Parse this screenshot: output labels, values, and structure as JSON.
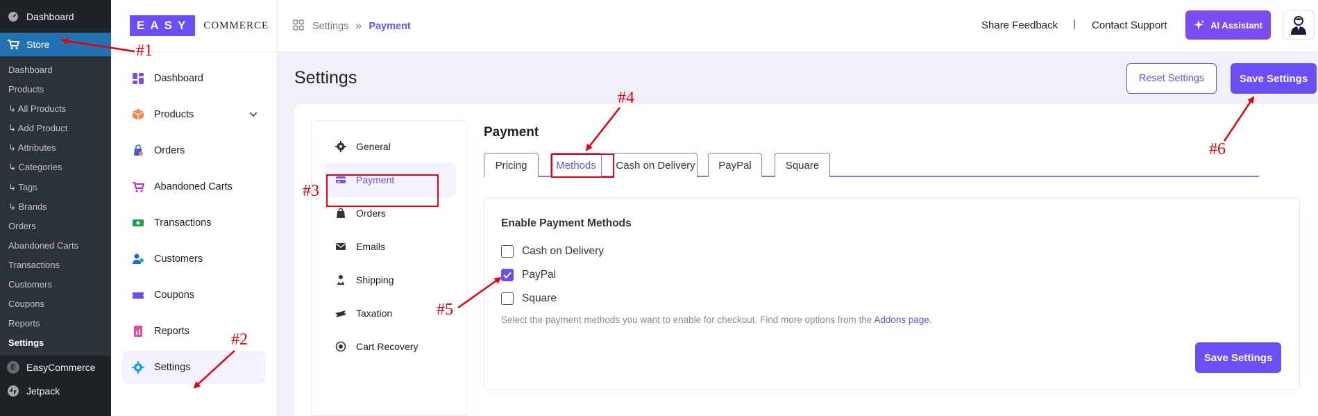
{
  "wp_sidebar": {
    "dashboard_label": "Dashboard",
    "store_label": "Store",
    "submenu": [
      "Dashboard",
      "Products",
      "�ₗ All Products",
      "�ₗ Add Product",
      "�ₗ Attributes",
      "�ₗ Categories",
      "�ₗ Tags",
      "�ₗ Brands",
      "Orders",
      "Abandoned Carts",
      "Transactions",
      "Customers",
      "Coupons",
      "Reports",
      "Settings"
    ],
    "easycommerce_label": "EasyCommerce",
    "easycommerce_initial": "E",
    "jetpack_label": "Jetpack"
  },
  "logo": {
    "box_text": "EASY",
    "text": "COMMERCE"
  },
  "ec_nav": {
    "items": [
      {
        "label": "Dashboard",
        "icon": "dashboard-icon"
      },
      {
        "label": "Products",
        "icon": "products-icon"
      },
      {
        "label": "Orders",
        "icon": "orders-icon"
      },
      {
        "label": "Abandoned Carts",
        "icon": "cart-icon"
      },
      {
        "label": "Transactions",
        "icon": "transactions-icon"
      },
      {
        "label": "Customers",
        "icon": "customers-icon"
      },
      {
        "label": "Coupons",
        "icon": "coupon-icon"
      },
      {
        "label": "Reports",
        "icon": "reports-icon"
      },
      {
        "label": "Settings",
        "icon": "gear-icon"
      }
    ]
  },
  "header": {
    "breadcrumb_settings": "Settings",
    "breadcrumb_sep": "»",
    "breadcrumb_current": "Payment",
    "share_feedback": "Share Feedback",
    "pipe": "|",
    "contact_support": "Contact Support",
    "ai_assistant": "AI Assistant"
  },
  "page": {
    "title": "Settings",
    "reset_label": "Reset Settings",
    "save_label": "Save Settings"
  },
  "settings_nav": [
    "General",
    "Payment",
    "Orders",
    "Emails",
    "Shipping",
    "Taxation",
    "Cart Recovery"
  ],
  "payment": {
    "title": "Payment",
    "tabs": [
      "Pricing",
      "Methods",
      "Cash on Delivery",
      "PayPal",
      "Square"
    ],
    "heading": "Enable Payment Methods",
    "methods": [
      {
        "label": "Cash on Delivery",
        "checked": false
      },
      {
        "label": "PayPal",
        "checked": true
      },
      {
        "label": "Square",
        "checked": false
      }
    ],
    "help_text": "Select the payment methods you want to enable for checkout. Find more options from the ",
    "help_link": "Addons page",
    "help_end": ".",
    "save_label": "Save Settings"
  },
  "annotations": [
    "#1",
    "#2",
    "#3",
    "#4",
    "#5",
    "#6"
  ],
  "colors": {
    "accent": "#6b4ef6",
    "wp_dark": "#1d2327",
    "wp_blue": "#2271b1",
    "annotation": "#e8000b"
  }
}
